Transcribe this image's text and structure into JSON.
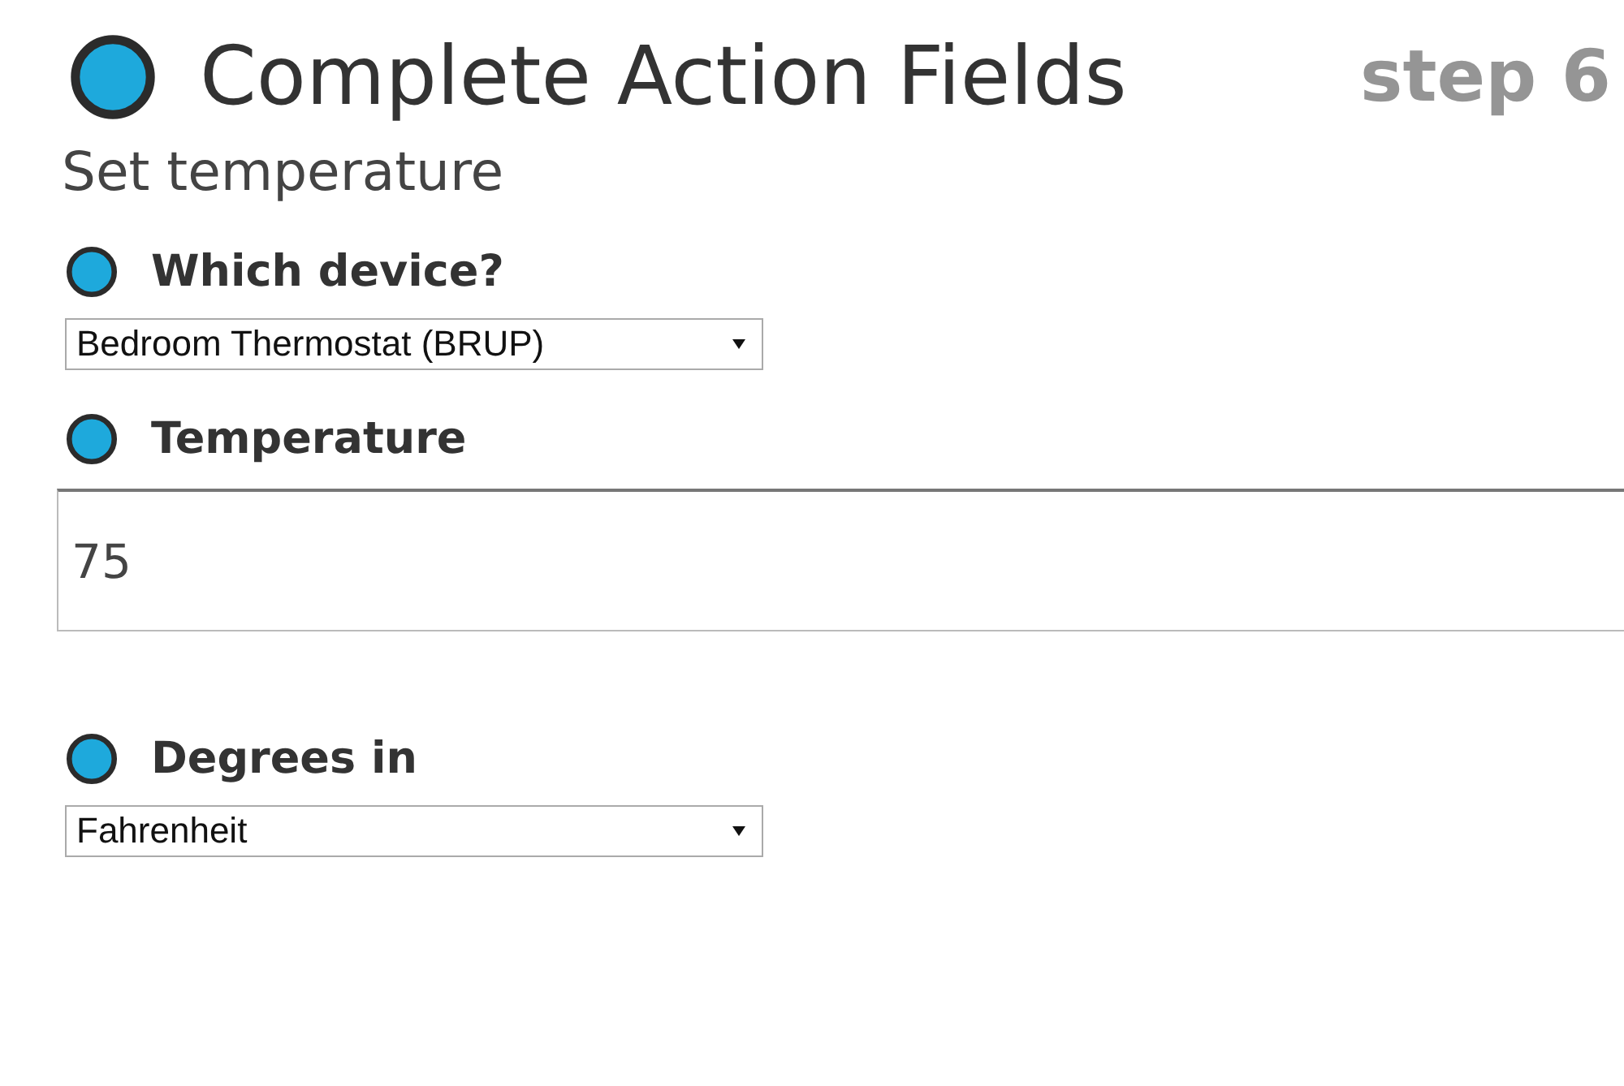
{
  "header": {
    "title": "Complete Action Fields",
    "step": "step 6"
  },
  "subtitle": "Set temperature",
  "fields": [
    {
      "kind": "select",
      "label": "Which device?",
      "value": "Bedroom Thermostat (BRUP)"
    },
    {
      "kind": "text",
      "label": "Temperature",
      "value": "75"
    },
    {
      "kind": "select",
      "label": "Degrees in",
      "value": "Fahrenheit"
    }
  ]
}
